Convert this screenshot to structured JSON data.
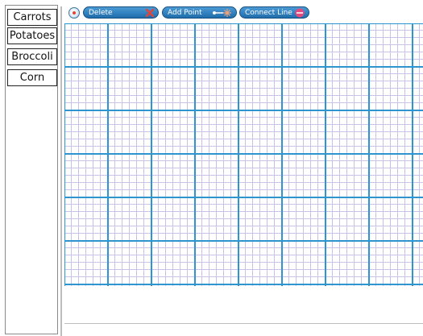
{
  "categories": [
    {
      "label": "Carrots"
    },
    {
      "label": "Potatoes"
    },
    {
      "label": "Broccoli"
    },
    {
      "label": "Corn"
    }
  ],
  "toolbar": {
    "delete_label": "Delete",
    "delete_icon": "x-icon",
    "add_point_label": "Add Point",
    "add_point_icon": "point-icon",
    "connect_line_label": "Connect Line",
    "connect_line_icon": "line-icon",
    "accent": "#2b7fc0",
    "delete_icon_color": "#e0453a"
  },
  "grid": {
    "major_color": "#2e95cf",
    "minor_color": "#c9c3ea",
    "minor_per_major": 6
  }
}
